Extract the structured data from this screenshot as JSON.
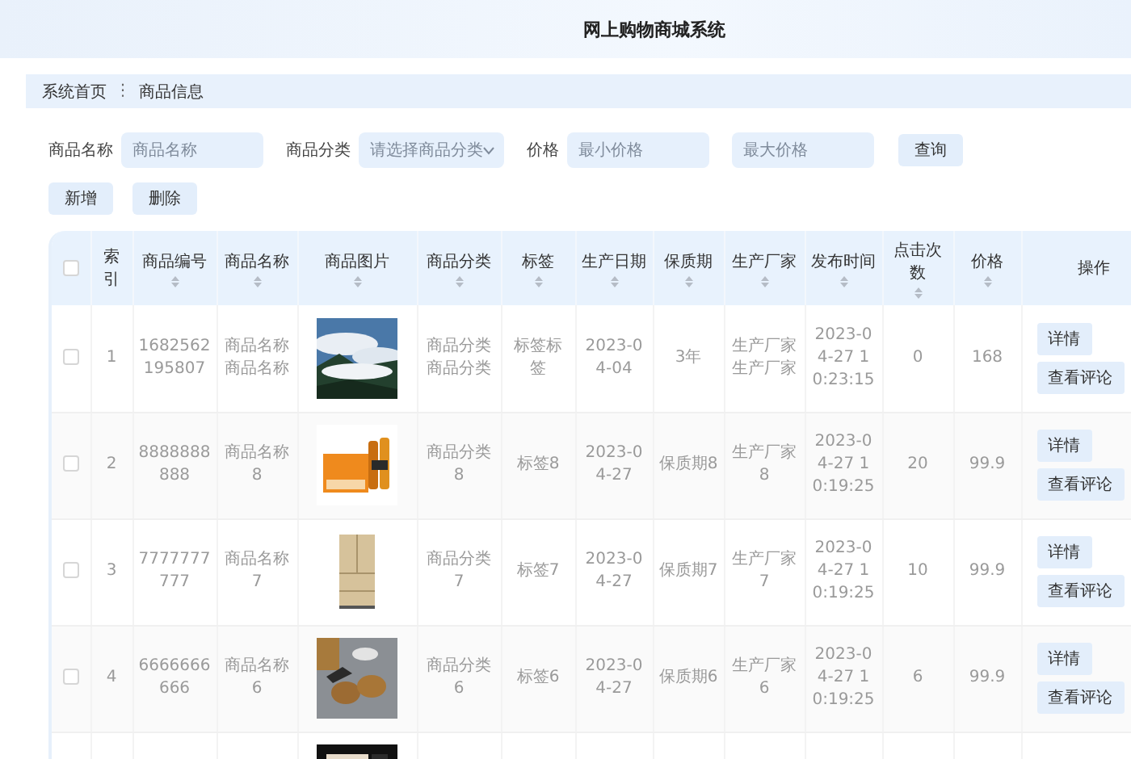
{
  "header": {
    "title": "网上购物商城系统"
  },
  "breadcrumb": {
    "items": [
      "系统首页",
      "商品信息"
    ],
    "separator": "⋮"
  },
  "search": {
    "fields": [
      {
        "kind": "input",
        "label": "商品名称",
        "placeholder": "商品名称"
      },
      {
        "kind": "select",
        "label": "商品分类",
        "placeholder": "请选择商品分类"
      },
      {
        "kind": "input",
        "label": "价格",
        "placeholder": "最小价格"
      },
      {
        "kind": "input",
        "placeholder": "最大价格"
      }
    ],
    "button": "查询"
  },
  "actions": [
    "新增",
    "删除"
  ],
  "table": {
    "all_selected": false,
    "columns": [
      {
        "label": "索引",
        "sortable": false
      },
      {
        "label": "商品编号",
        "sortable": true
      },
      {
        "label": "商品名称",
        "sortable": true
      },
      {
        "label": "商品图片",
        "sortable": true
      },
      {
        "label": "商品分类",
        "sortable": true
      },
      {
        "label": "标签",
        "sortable": true
      },
      {
        "label": "生产日期",
        "sortable": true
      },
      {
        "label": "保质期",
        "sortable": true
      },
      {
        "label": "生产厂家",
        "sortable": true
      },
      {
        "label": "发布时间",
        "sortable": true
      },
      {
        "label": "点击次数",
        "sortable": true
      },
      {
        "label": "价格",
        "sortable": true
      },
      {
        "label": "操作",
        "sortable": false
      }
    ],
    "rows": [
      {
        "selected": false,
        "cells": [
          "1",
          "1682562195807",
          "商品名称商品名称",
          {
            "kind": "picture"
          },
          "商品分类商品分类",
          "标签标签",
          "2023-04-04",
          "3年",
          "生产厂家生产厂家",
          "2023-04-27 10:23:15",
          "0",
          "168"
        ],
        "actions": [
          "详情",
          "查看评论"
        ]
      },
      {
        "selected": false,
        "cells": [
          "2",
          "8888888888",
          "商品名称8",
          {
            "kind": "picture"
          },
          "商品分类8",
          "标签8",
          "2023-04-27",
          "保质期8",
          "生产厂家8",
          "2023-04-27 10:19:25",
          "20",
          "99.9"
        ],
        "actions": [
          "详情",
          "查看评论"
        ]
      },
      {
        "selected": false,
        "cells": [
          "3",
          "7777777777",
          "商品名称7",
          {
            "kind": "picture"
          },
          "商品分类7",
          "标签7",
          "2023-04-27",
          "保质期7",
          "生产厂家7",
          "2023-04-27 10:19:25",
          "10",
          "99.9"
        ],
        "actions": [
          "详情",
          "查看评论"
        ]
      },
      {
        "selected": false,
        "cells": [
          "4",
          "6666666666",
          "商品名称6",
          {
            "kind": "picture"
          },
          "商品分类6",
          "标签6",
          "2023-04-27",
          "保质期6",
          "生产厂家6",
          "2023-04-27 10:19:25",
          "6",
          "99.9"
        ],
        "actions": [
          "详情",
          "查看评论"
        ]
      },
      {
        "cells": [
          "",
          "",
          "",
          {
            "kind": "picture"
          }
        ]
      }
    ]
  }
}
